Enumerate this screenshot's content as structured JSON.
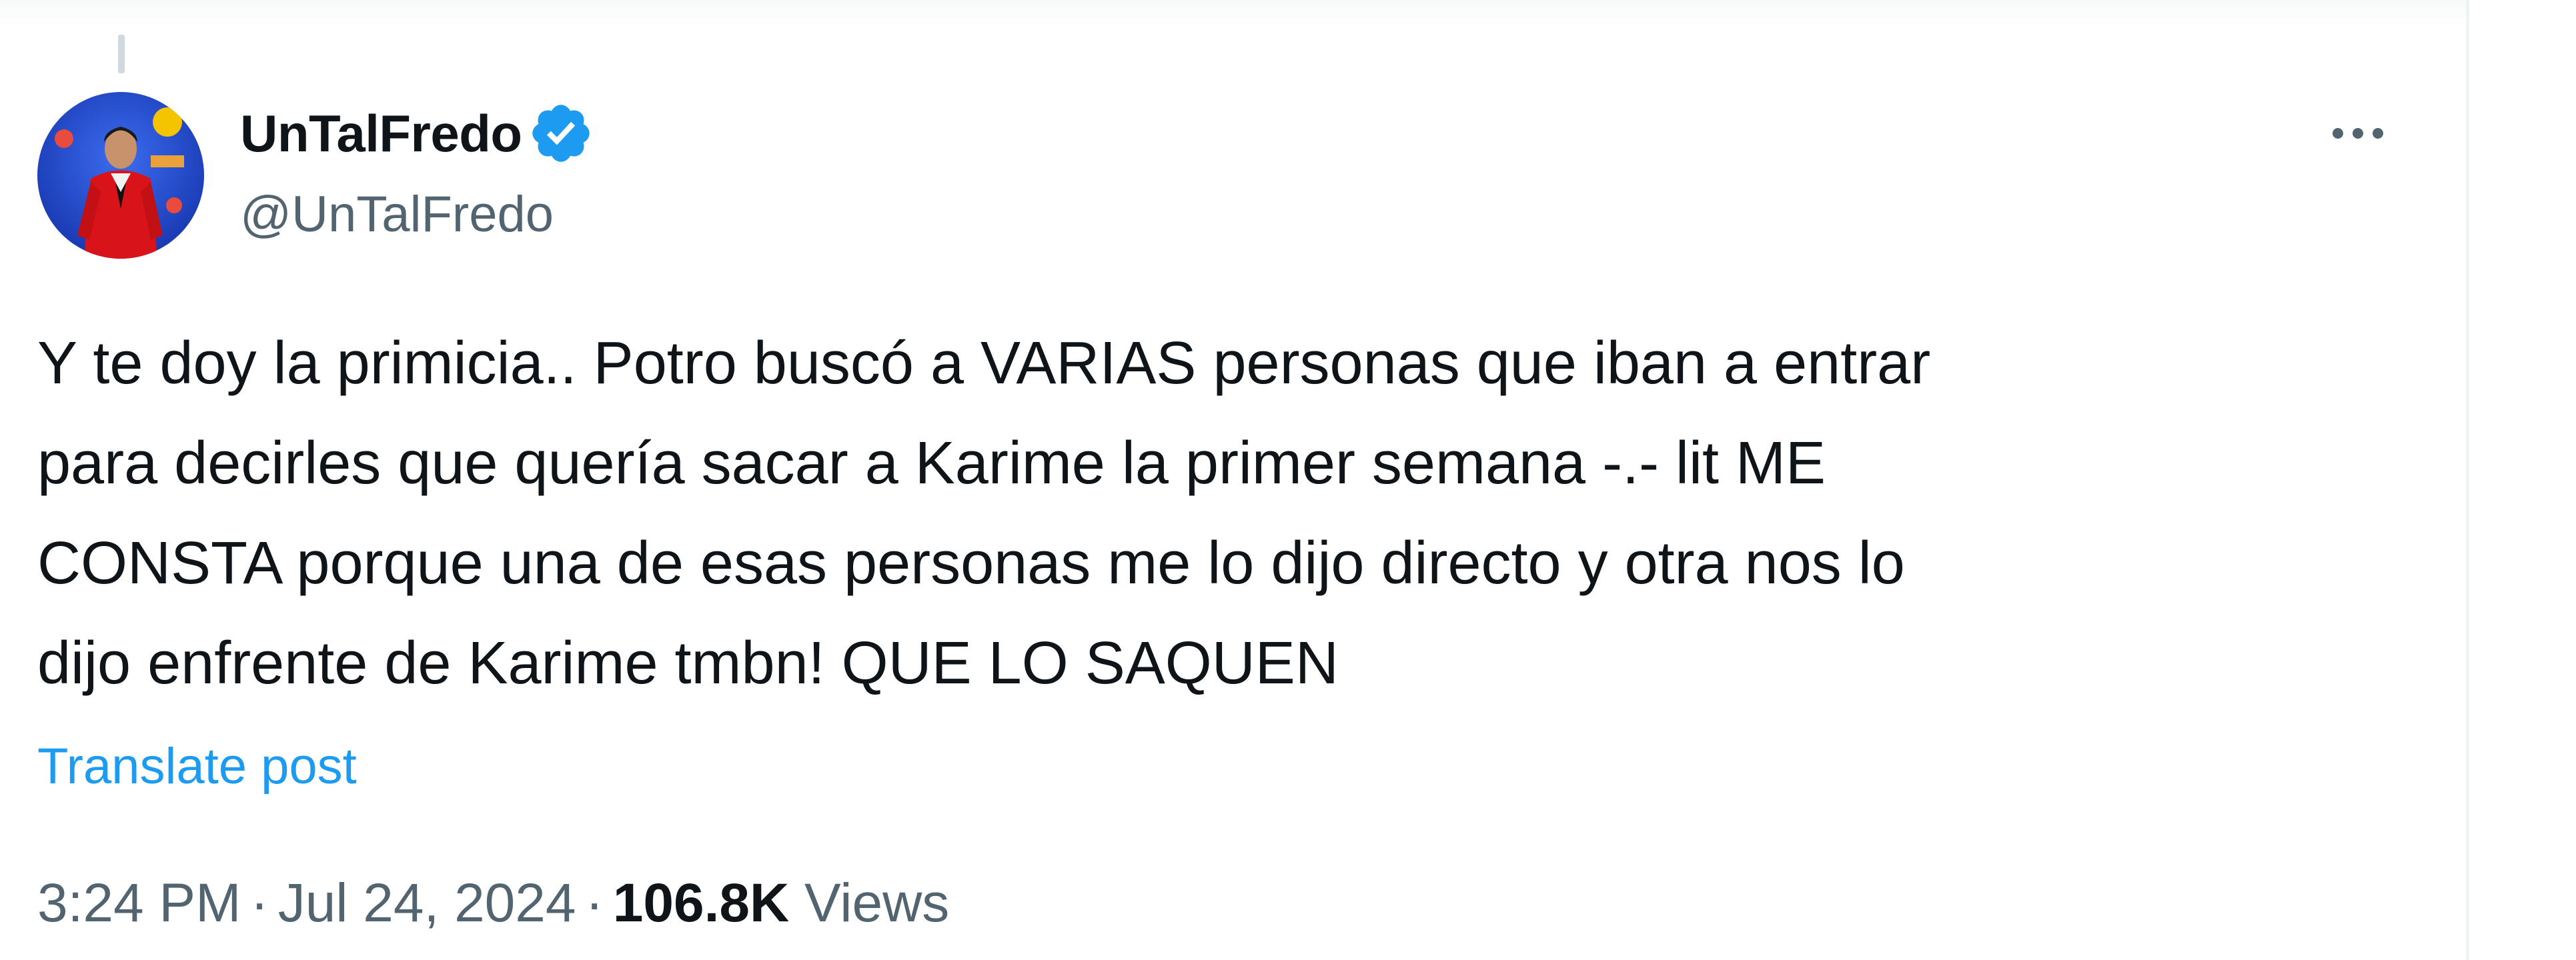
{
  "post": {
    "author": {
      "display_name": "UnTalFredo",
      "handle": "@UnTalFredo",
      "verified": true
    },
    "text_lines": [
      "Y te doy la primicia.. Potro buscó a VARIAS personas que iban a entrar",
      "para decirles que quería sacar a Karime la primer semana -.- lit ME",
      "CONSTA porque una de esas personas me lo dijo directo y otra nos lo",
      "dijo enfrente de Karime tmbn! QUE LO SAQUEN"
    ],
    "translate_label": "Translate post",
    "time": "3:24 PM",
    "date": "Jul 24, 2024",
    "separator": "·",
    "views_count": "106.8K",
    "views_label": "Views"
  },
  "icons": {
    "verified": "verified-badge-icon",
    "more": "more-options-icon"
  },
  "colors": {
    "accent": "#1d9bf0",
    "text_primary": "#0f1419",
    "text_secondary": "#536471"
  }
}
